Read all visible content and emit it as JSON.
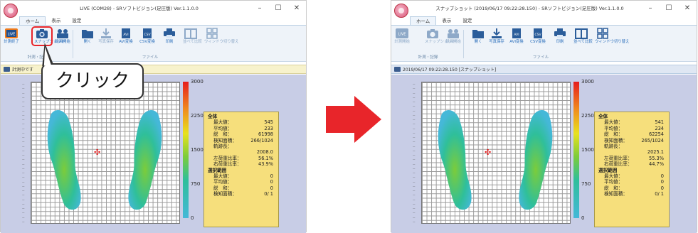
{
  "left_window": {
    "title": "LIVE (COM28) - SRソフトビジョン(足圧版) Ver.1.1.0.0",
    "menu_tabs": [
      "ホーム",
      "表示",
      "設定"
    ],
    "ribbon": {
      "buttons": [
        "計測終了",
        "スナップショット",
        "録画開始",
        "開く",
        "写真保存",
        "AVI変換",
        "CSV変換",
        "印刷",
        "並べて比較",
        "ウィンドウ切り替え"
      ],
      "groups": [
        "計測・記録",
        "ファイル"
      ]
    },
    "status_text": "計測中です",
    "stats": {
      "header_all": "全体",
      "rows_all": [
        {
          "k": "最大値：",
          "v": "545"
        },
        {
          "k": "平均値：",
          "v": "233"
        },
        {
          "k": "総　和：",
          "v": "61998"
        },
        {
          "k": "検知面積：",
          "v": "266/1024"
        },
        {
          "k": "軌跡長：",
          "v": ""
        },
        {
          "k": "",
          "v": "2008.0"
        },
        {
          "k": "左荷重比率：",
          "v": "56.1%"
        },
        {
          "k": "右荷重比率：",
          "v": "43.9%"
        }
      ],
      "header_sel": "選択範囲",
      "rows_sel": [
        {
          "k": "最大値：",
          "v": "0"
        },
        {
          "k": "平均値：",
          "v": "0"
        },
        {
          "k": "総　和：",
          "v": "0"
        },
        {
          "k": "検知面積：",
          "v": "0/ 1"
        }
      ]
    },
    "colorbar_labels": [
      "3000",
      "2250",
      "1500",
      "750",
      "0"
    ],
    "callout": "クリック"
  },
  "right_window": {
    "title": "スナップショット (2019/06/17 09:22:28.150) - SRソフトビジョン(足圧版) Ver.1.1.0.0",
    "menu_tabs": [
      "ホーム",
      "表示",
      "設定"
    ],
    "ribbon": {
      "buttons": [
        "計測開始",
        "スナップショット",
        "録画開始",
        "開く",
        "写真保存",
        "AVI変換",
        "CSV変換",
        "印刷",
        "並べて比較",
        "ウィンドウ切り替え"
      ],
      "groups": [
        "計測・記録",
        "ファイル"
      ]
    },
    "status_text": "2019/06/17 09:22:28.150 [スナップショット]",
    "stats": {
      "header_all": "全体",
      "rows_all": [
        {
          "k": "最大値：",
          "v": "541"
        },
        {
          "k": "平均値：",
          "v": "234"
        },
        {
          "k": "総　和：",
          "v": "62254"
        },
        {
          "k": "検知面積：",
          "v": "265/1024"
        },
        {
          "k": "軌跡長：",
          "v": ""
        },
        {
          "k": "",
          "v": "2025.1"
        },
        {
          "k": "左荷重比率：",
          "v": "55.3%"
        },
        {
          "k": "右荷重比率：",
          "v": "44.7%"
        }
      ],
      "header_sel": "選択範囲",
      "rows_sel": [
        {
          "k": "最大値：",
          "v": "0"
        },
        {
          "k": "平均値：",
          "v": "0"
        },
        {
          "k": "総　和：",
          "v": "0"
        },
        {
          "k": "検知面積：",
          "v": "0/ 1"
        }
      ]
    },
    "colorbar_labels": [
      "3000",
      "2250",
      "1500",
      "750",
      "0"
    ]
  },
  "colors": {
    "accent": "#2a6ebb",
    "arrow": "#e8252a",
    "stats_bg": "#f6df7c",
    "view_bg": "#c8cde6"
  },
  "icons": [
    "app-logo-icon",
    "minimize-icon",
    "maximize-icon",
    "close-icon",
    "live-icon",
    "camera-icon",
    "record-icon",
    "folder-icon",
    "save-photo-icon",
    "avi-icon",
    "csv-icon",
    "print-icon",
    "compare-icon",
    "window-switch-icon"
  ]
}
